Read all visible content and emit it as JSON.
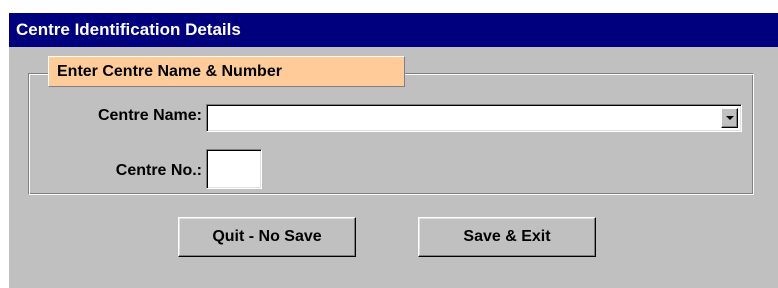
{
  "window": {
    "title": "Centre Identification Details",
    "title_bg": "#00007f",
    "body_bg": "#c0c0c0"
  },
  "group": {
    "legend": "Enter Centre Name & Number",
    "legend_bg": "#ffcc99"
  },
  "fields": {
    "centre_name_label": "Centre Name:",
    "centre_name_value": "",
    "centre_no_label": "Centre No.:",
    "centre_no_value": ""
  },
  "buttons": {
    "quit_label": "Quit - No Save",
    "save_label": "Save & Exit"
  },
  "icons": {
    "dropdown": "chevron-down-icon"
  }
}
